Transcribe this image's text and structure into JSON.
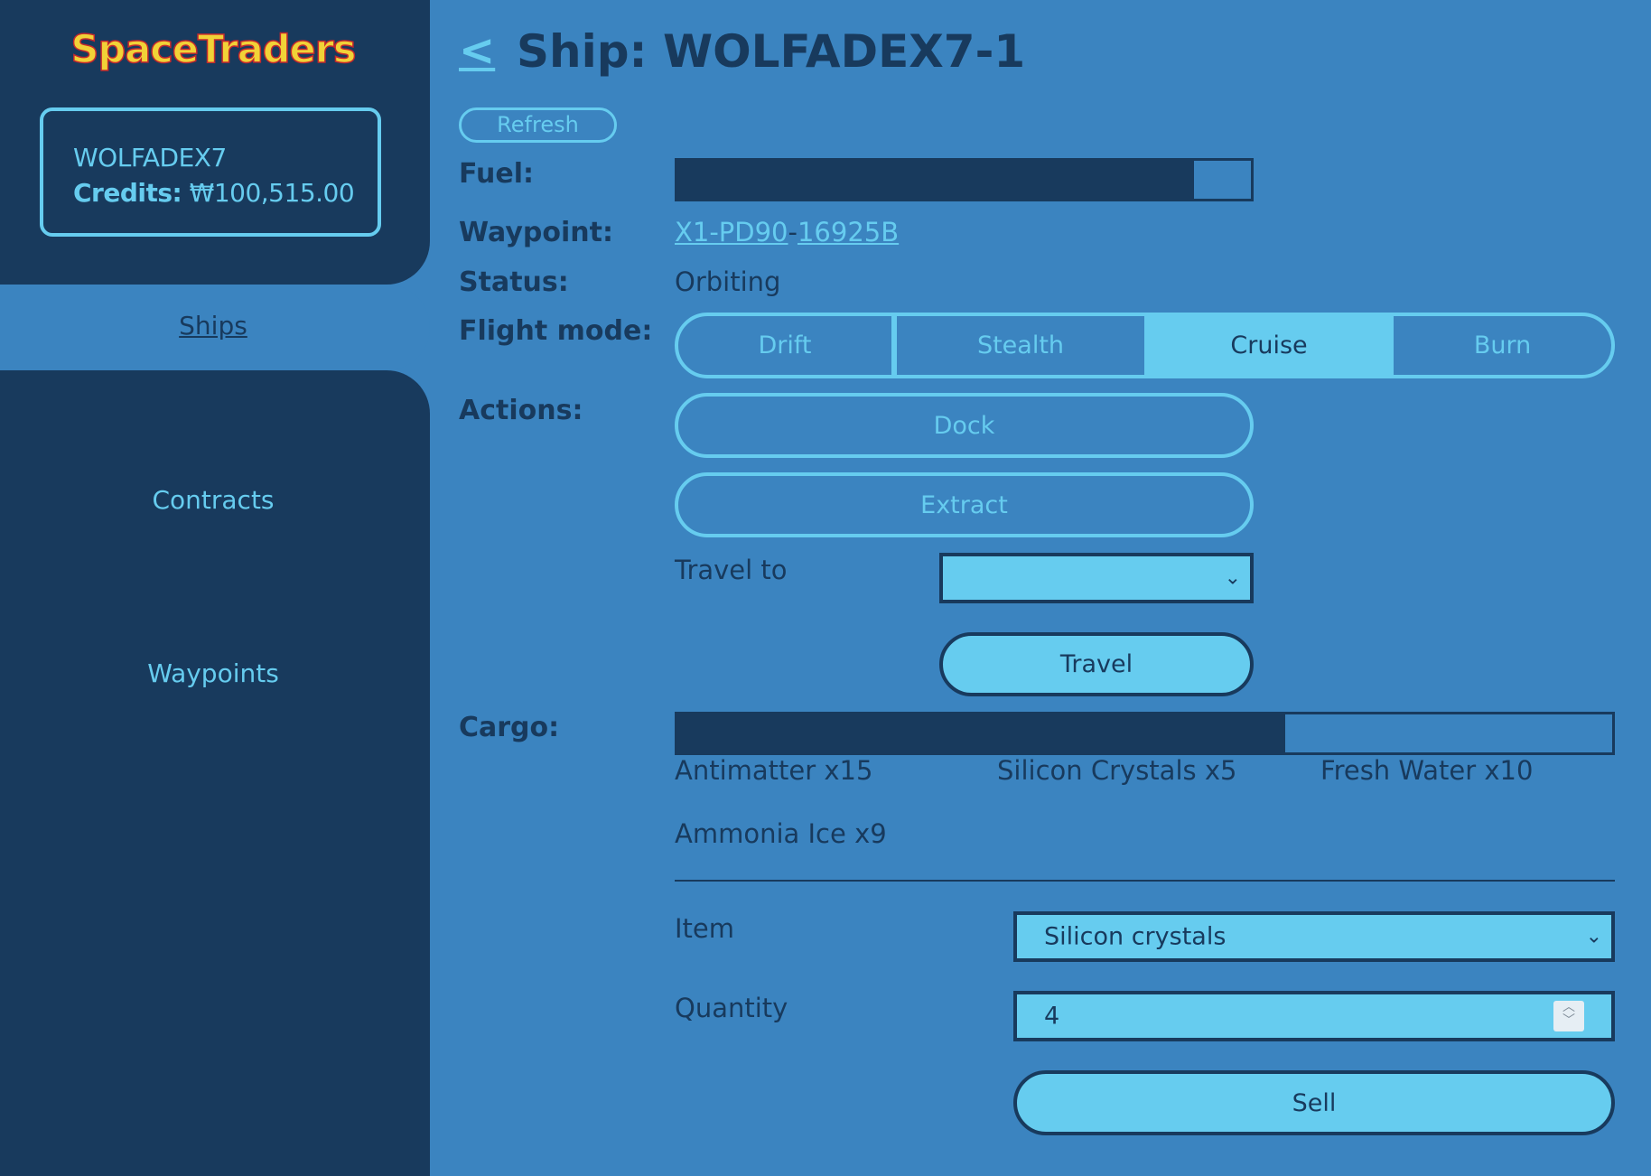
{
  "app": {
    "logo": "SpaceTraders"
  },
  "account": {
    "username": "WOLFADEX7",
    "credits_label": "Credits:",
    "credits_value": "₩100,515.00"
  },
  "nav": {
    "ships": "Ships",
    "contracts": "Contracts",
    "waypoints": "Waypoints",
    "active": "Ships"
  },
  "header": {
    "back": "<",
    "title": "Ship: WOLFADEX7-1"
  },
  "actions_bar": {
    "refresh": "Refresh"
  },
  "ship": {
    "fuel_label": "Fuel:",
    "fuel_fraction": 0.9,
    "waypoint_label": "Waypoint:",
    "waypoint_system": "X1-PD90",
    "waypoint_separator": "-",
    "waypoint_id": "16925B",
    "status_label": "Status:",
    "status": "Orbiting",
    "flight_mode_label": "Flight mode:",
    "flight_modes": [
      "Drift",
      "Stealth",
      "Cruise",
      "Burn"
    ],
    "flight_mode_selected": "Cruise",
    "actions_label": "Actions:",
    "dock": "Dock",
    "extract": "Extract",
    "travel_to_label": "Travel to",
    "travel_to_value": "",
    "travel": "Travel"
  },
  "cargo": {
    "label": "Cargo:",
    "fill_fraction": 0.65,
    "items": [
      "Antimatter x15",
      "Silicon Crystals x5",
      "Fresh Water x10",
      "Ammonia Ice x9"
    ],
    "sell_form": {
      "item_label": "Item",
      "item_value": "Silicon crystals",
      "quantity_label": "Quantity",
      "quantity_value": "4",
      "sell": "Sell"
    }
  },
  "colors": {
    "dark": "#183a5d",
    "mid": "#3b84c0",
    "light": "#66ccef",
    "logo_fill": "#f1d237",
    "logo_outline": "#c5282d"
  }
}
